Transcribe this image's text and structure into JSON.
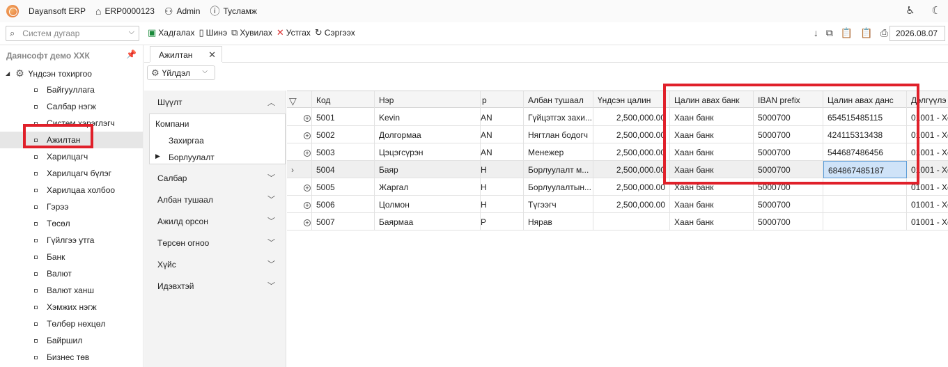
{
  "app": {
    "name": "Dayansoft ERP",
    "user_id": "ERP0000123",
    "user": "Admin",
    "help": "Тусламж"
  },
  "toolbar": {
    "search_placeholder": "Систем дугаар",
    "save": "Хадгалах",
    "new": "Шинэ",
    "copy": "Хувилах",
    "delete": "Устгах",
    "refresh": "Сэргээх",
    "date": "2026.08.07"
  },
  "sidebar": {
    "company": "Даянсофт демо ХХК",
    "root": "Үндсэн тохиргоо",
    "items": [
      {
        "label": "Байгууллага"
      },
      {
        "label": "Салбар нэгж"
      },
      {
        "label": "Систем хэрэглэгч"
      },
      {
        "label": "Ажилтан"
      },
      {
        "label": "Харилцагч"
      },
      {
        "label": "Харилцагч бүлэг"
      },
      {
        "label": "Харилцаа холбоо"
      },
      {
        "label": "Гэрээ"
      },
      {
        "label": "Төсөл"
      },
      {
        "label": "Гүйлгээ утга"
      },
      {
        "label": "Банк"
      },
      {
        "label": "Валют"
      },
      {
        "label": "Валют ханш"
      },
      {
        "label": "Хэмжих нэгж"
      },
      {
        "label": "Төлбөр нөхцөл"
      },
      {
        "label": "Байршил"
      },
      {
        "label": "Бизнес төв"
      }
    ]
  },
  "tab": {
    "label": "Ажилтан",
    "action_menu": "Үйлдэл"
  },
  "filter": {
    "title": "Шүүлт",
    "company_label": "Компани",
    "company_options": [
      "Захиргаа",
      "Борлуулалт"
    ],
    "groups": [
      "Салбар",
      "Албан тушаал",
      "Ажилд орсон",
      "Төрсөн огноо",
      "Хүйс",
      "Идэвхтэй"
    ]
  },
  "grid": {
    "columns": [
      "",
      "Код",
      "Нэр",
      "р",
      "Албан тушаал",
      "Үндсэн цалин",
      "Цалин авах банк",
      "IBAN prefix",
      "Цалин авах данс",
      "Дэлгүүлэ"
    ],
    "rows": [
      {
        "code": "5001",
        "name": "Kevin",
        "c3": "AN",
        "position": "Гүйцэтгэх захи...",
        "salary": "2,500,000.00",
        "bank": "Хаан банк",
        "iban": "5000700",
        "account": "654515485115",
        "last": "01001 - Хе"
      },
      {
        "code": "5002",
        "name": "Долгормаа",
        "c3": "AN",
        "position": "Нягтлан бодогч",
        "salary": "2,500,000.00",
        "bank": "Хаан банк",
        "iban": "5000700",
        "account": "424115313438",
        "last": "01001 - Хе"
      },
      {
        "code": "5003",
        "name": "Цэцэгсүрэн",
        "c3": "AN",
        "position": "Менежер",
        "salary": "2,500,000.00",
        "bank": "Хаан банк",
        "iban": "5000700",
        "account": "544687486456",
        "last": "01001 - Хе"
      },
      {
        "code": "5004",
        "name": "Баяр",
        "c3": "H",
        "position": "Борлуулалт м...",
        "salary": "2,500,000.00",
        "bank": "Хаан банк",
        "iban": "5000700",
        "account": "684867485187",
        "last": "01001 - Хе"
      },
      {
        "code": "5005",
        "name": "Жаргал",
        "c3": "H",
        "position": "Борлуулалтын...",
        "salary": "2,500,000.00",
        "bank": "Хаан банк",
        "iban": "5000700",
        "account": "",
        "last": "01001 - Хе"
      },
      {
        "code": "5006",
        "name": "Цолмон",
        "c3": "H",
        "position": "Түгээгч",
        "salary": "2,500,000.00",
        "bank": "Хаан банк",
        "iban": "5000700",
        "account": "",
        "last": "01001 - Хе"
      },
      {
        "code": "5007",
        "name": "Баярмаа",
        "c3": "P",
        "position": "Нярав",
        "salary": "",
        "bank": "Хаан банк",
        "iban": "5000700",
        "account": "",
        "last": "01001 - Хе"
      }
    ]
  }
}
